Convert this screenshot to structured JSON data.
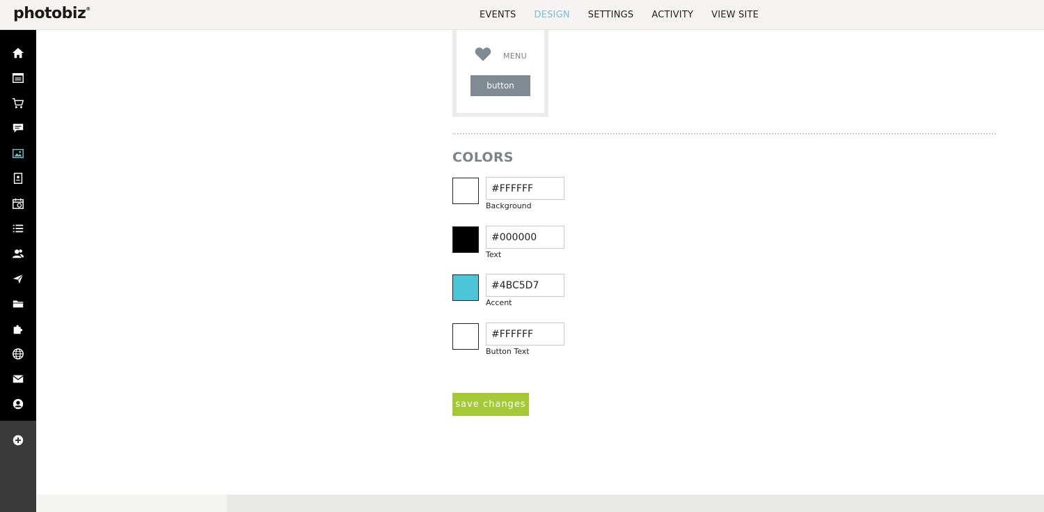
{
  "app": {
    "logo_text": "photobiz",
    "logo_mark": "®"
  },
  "topnav": {
    "items": [
      {
        "label": "EVENTS",
        "active": false
      },
      {
        "label": "DESIGN",
        "active": true
      },
      {
        "label": "SETTINGS",
        "active": false
      },
      {
        "label": "ACTIVITY",
        "active": false
      },
      {
        "label": "VIEW SITE",
        "active": false
      }
    ],
    "active_color": "#7cbcd1"
  },
  "sidebar": {
    "icons": [
      "home-icon",
      "website-icon",
      "cart-icon",
      "chat-icon",
      "gallery-icon",
      "document-icon",
      "calendar-icon",
      "list-icon",
      "contacts-icon",
      "send-icon",
      "folder-icon",
      "puzzle-icon",
      "globe-icon",
      "mail-icon",
      "account-icon",
      "add-icon"
    ],
    "active_icon": "gallery-icon",
    "active_color": "#7cbcd1"
  },
  "preview": {
    "menu_label": "MENU",
    "button_label": "button",
    "button_color": "#7f8a93"
  },
  "colors": {
    "title": "COLORS",
    "items": [
      {
        "value": "#FFFFFF",
        "label": "Background",
        "swatch": "#ffffff"
      },
      {
        "value": "#000000",
        "label": "Text",
        "swatch": "#000000"
      },
      {
        "value": "#4BC5D7",
        "label": "Accent",
        "swatch": "#4bc5d7"
      },
      {
        "value": "#FFFFFF",
        "label": "Button Text",
        "swatch": "#ffffff"
      }
    ]
  },
  "actions": {
    "save_label": "save changes",
    "save_color": "#a4c837"
  }
}
